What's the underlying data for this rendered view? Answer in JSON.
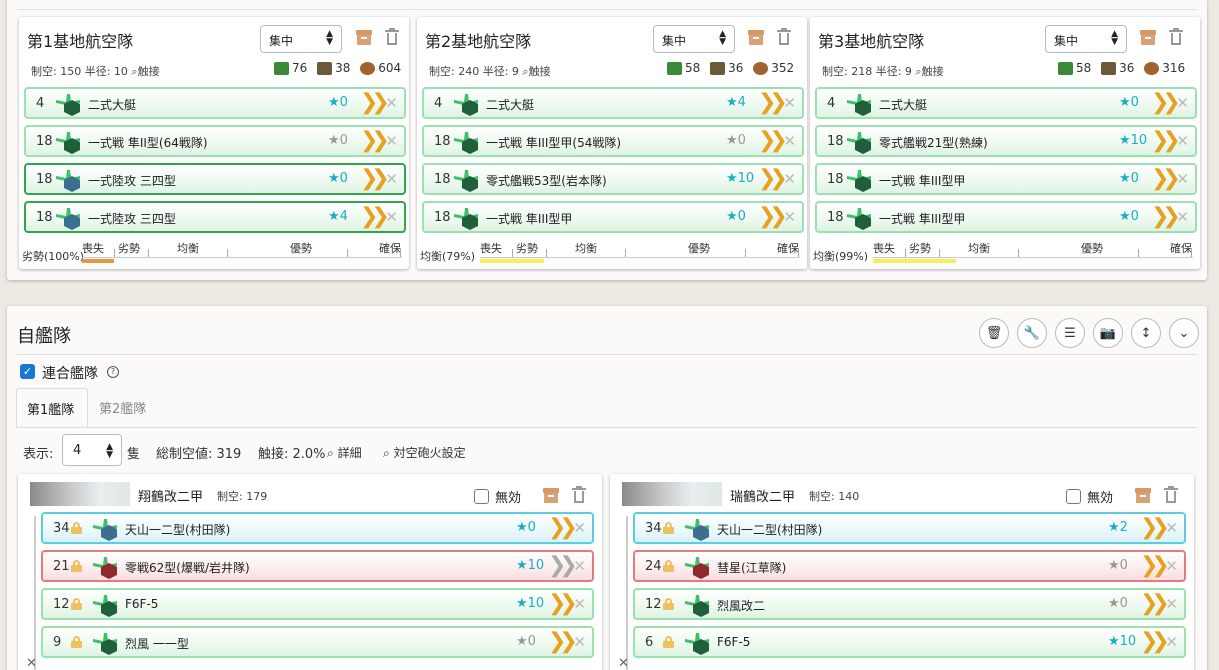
{
  "air_bases": [
    {
      "title": "第1基地航空隊",
      "mode": "集中",
      "stats": "制空: 150 半径: 10",
      "contact_label": "触接",
      "resources": {
        "fuel": "76",
        "ammo": "38",
        "bauxite": "604"
      },
      "slots": [
        {
          "count": "4",
          "name": "二式大艇",
          "prof": "0",
          "star_color": "#1aaec0",
          "style": "normal"
        },
        {
          "count": "18",
          "name": "一式戦 隼II型(64戦隊)",
          "prof": "0",
          "star_color": "#999999",
          "style": "normal"
        },
        {
          "count": "18",
          "name": "一式陸攻 三四型",
          "prof": "0",
          "star_color": "#1aaec0",
          "style": "dark"
        },
        {
          "count": "18",
          "name": "一式陸攻 三四型",
          "prof": "4",
          "star_color": "#1aaec0",
          "style": "dark"
        }
      ],
      "status": "劣勢(100%)",
      "scale": [
        "喪失",
        "劣勢",
        "均衡",
        "優勢",
        "確保"
      ],
      "bar": {
        "color": "#e8954a",
        "fraction": 0.1
      }
    },
    {
      "title": "第2基地航空隊",
      "mode": "集中",
      "stats": "制空: 240 半径: 9",
      "contact_label": "触接",
      "resources": {
        "fuel": "58",
        "ammo": "36",
        "bauxite": "352"
      },
      "slots": [
        {
          "count": "4",
          "name": "二式大艇",
          "prof": "4",
          "star_color": "#1aaec0",
          "style": "normal"
        },
        {
          "count": "18",
          "name": "一式戦 隼III型甲(54戦隊)",
          "prof": "0",
          "star_color": "#999999",
          "style": "normal"
        },
        {
          "count": "18",
          "name": "零式艦戦53型(岩本隊)",
          "prof": "10",
          "star_color": "#1aaec0",
          "style": "normal"
        },
        {
          "count": "18",
          "name": "一式戦 隼III型甲",
          "prof": "0",
          "star_color": "#1aaec0",
          "style": "normal"
        }
      ],
      "status": "均衡(79%)",
      "scale": [
        "喪失",
        "劣勢",
        "均衡",
        "優勢",
        "確保"
      ],
      "bar": {
        "color": "#f3ef5a",
        "fraction": 0.2
      }
    },
    {
      "title": "第3基地航空隊",
      "mode": "集中",
      "stats": "制空: 218 半径: 9",
      "contact_label": "触接",
      "resources": {
        "fuel": "58",
        "ammo": "36",
        "bauxite": "316"
      },
      "slots": [
        {
          "count": "4",
          "name": "二式大艇",
          "prof": "0",
          "star_color": "#1aaec0",
          "style": "normal"
        },
        {
          "count": "18",
          "name": "零式艦戦21型(熟練)",
          "prof": "10",
          "star_color": "#1aaec0",
          "style": "normal"
        },
        {
          "count": "18",
          "name": "一式戦 隼III型甲",
          "prof": "0",
          "star_color": "#1aaec0",
          "style": "normal"
        },
        {
          "count": "18",
          "name": "一式戦 隼III型甲",
          "prof": "0",
          "star_color": "#1aaec0",
          "style": "normal"
        }
      ],
      "status": "均衡(99%)",
      "scale": [
        "喪失",
        "劣勢",
        "均衡",
        "優勢",
        "確保"
      ],
      "bar": {
        "color": "#f3ef5a",
        "fraction": 0.26
      }
    }
  ],
  "fleet": {
    "title": "自艦隊",
    "combined_label": "連合艦隊",
    "help": "?",
    "tabs": [
      "第1艦隊",
      "第2艦隊"
    ],
    "display_label": "表示:",
    "display_value": "4",
    "display_unit": "隻",
    "total_air": "総制空値: 319",
    "contact": "触接: 2.0%",
    "detail_label": "詳細",
    "aa_label": "対空砲火設定",
    "ships": [
      {
        "name": "翔鶴改二甲",
        "air": "制空: 179",
        "disable_label": "無効",
        "slots": [
          {
            "count": "34",
            "name": "天山一二型(村田隊)",
            "prof": "0",
            "star_color": "#1aaec0",
            "style": "blue",
            "chev": "orange"
          },
          {
            "count": "21",
            "name": "零戦62型(爆戦/岩井隊)",
            "prof": "10",
            "star_color": "#1aaec0",
            "style": "red",
            "chev": "gray"
          },
          {
            "count": "12",
            "name": "F6F-5",
            "prof": "10",
            "star_color": "#1aaec0",
            "style": "normal",
            "chev": "orange"
          },
          {
            "count": "9",
            "name": "烈風 一一型",
            "prof": "0",
            "star_color": "#999999",
            "style": "normal",
            "chev": "orange"
          }
        ]
      },
      {
        "name": "瑞鶴改二甲",
        "air": "制空: 140",
        "disable_label": "無効",
        "slots": [
          {
            "count": "34",
            "name": "天山一二型(村田隊)",
            "prof": "2",
            "star_color": "#1aaec0",
            "style": "blue",
            "chev": "orange"
          },
          {
            "count": "24",
            "name": "彗星(江草隊)",
            "prof": "0",
            "star_color": "#999999",
            "style": "red",
            "chev": "orange"
          },
          {
            "count": "12",
            "name": "烈風改二",
            "prof": "0",
            "star_color": "#999999",
            "style": "normal",
            "chev": "orange"
          },
          {
            "count": "6",
            "name": "F6F-5",
            "prof": "10",
            "star_color": "#1aaec0",
            "style": "normal",
            "chev": "orange"
          }
        ]
      }
    ]
  }
}
